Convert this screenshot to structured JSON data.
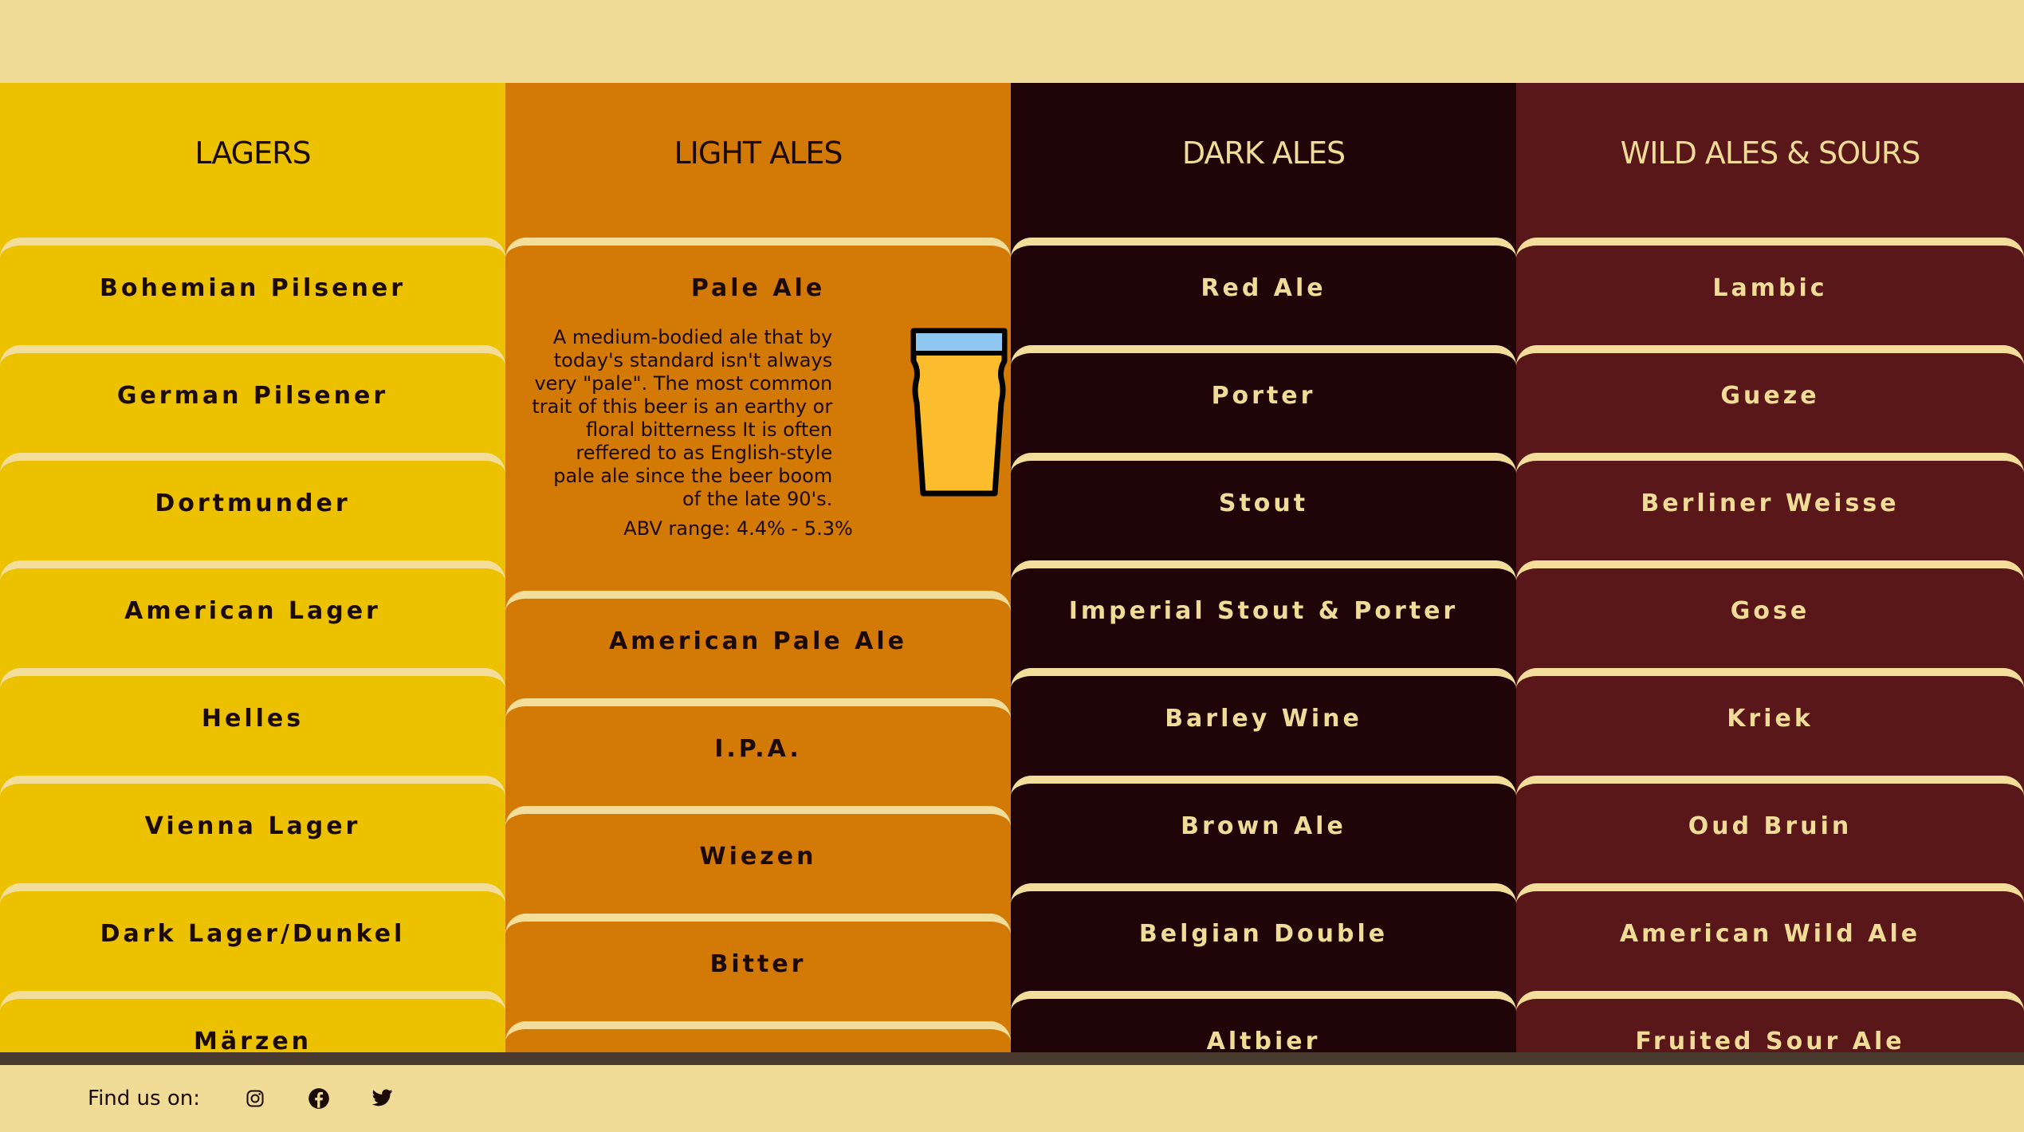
{
  "columns": [
    {
      "title": "LAGERS",
      "items": [
        "Bohemian Pilsener",
        "German Pilsener",
        "Dortmunder",
        "American Lager",
        "Helles",
        "Vienna Lager",
        "Dark Lager/Dunkel",
        "Märzen"
      ]
    },
    {
      "title": "LIGHT ALES",
      "items": [
        "Pale Ale",
        "American Pale Ale",
        "I.P.A.",
        "Wiezen",
        "Bitter",
        ""
      ],
      "expanded": {
        "name": "Pale Ale",
        "description": "A medium-bodied ale that by today's standard isn't always very \"pale\". The most common trait of this beer is an earthy or floral bitterness It is often reffered to as English-style pale ale since the beer boom of the late 90's.",
        "abv": "ABV range: 4.4% - 5.3%",
        "icon": "pint-glass-icon"
      }
    },
    {
      "title": "DARK ALES",
      "items": [
        "Red Ale",
        "Porter",
        "Stout",
        "Imperial Stout & Porter",
        "Barley Wine",
        "Brown Ale",
        "Belgian Double",
        "Altbier"
      ]
    },
    {
      "title": "WILD ALES & SOURS",
      "items": [
        "Lambic",
        "Gueze",
        "Berliner Weisse",
        "Gose",
        "Kriek",
        "Oud Bruin",
        "American Wild Ale",
        "Fruited Sour Ale"
      ]
    }
  ],
  "footer": {
    "label": "Find us on:",
    "icons": [
      "instagram-icon",
      "facebook-icon",
      "twitter-icon"
    ]
  },
  "colors": {
    "background": "#f0dc96",
    "lagers": "#ecc200",
    "light_ales": "#d37906",
    "dark_ales": "#1f0507",
    "wild_ales": "#5a1719",
    "glass_beer": "#fbbd2d",
    "glass_foam": "#8ec8f0"
  }
}
